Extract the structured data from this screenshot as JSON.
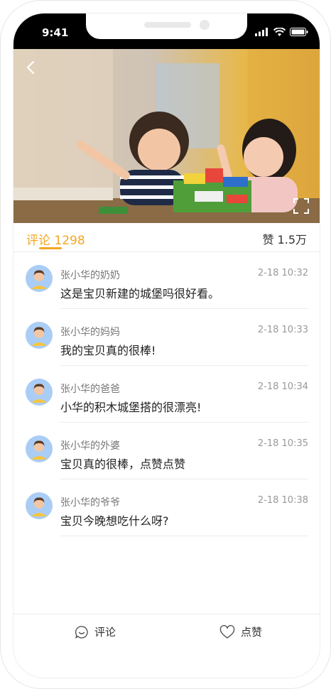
{
  "status_bar": {
    "time": "9:41"
  },
  "tabs": {
    "comments_label": "评论",
    "comments_count": "1298",
    "likes_label": "赞",
    "likes_count": "1.5万"
  },
  "comments": [
    {
      "name": "张小华的奶奶",
      "time": "2-18 10:32",
      "text": "这是宝贝新建的城堡吗很好看。"
    },
    {
      "name": "张小华的妈妈",
      "time": "2-18 10:33",
      "text": "我的宝贝真的很棒!"
    },
    {
      "name": "张小华的爸爸",
      "time": "2-18 10:34",
      "text": "小华的积木城堡搭的很漂亮!"
    },
    {
      "name": "张小华的外婆",
      "time": "2-18 10:35",
      "text": "宝贝真的很棒，点赞点赞"
    },
    {
      "name": "张小华的爷爷",
      "time": "2-18 10:38",
      "text": "宝贝今晚想吃什么呀?"
    }
  ],
  "bottom_bar": {
    "comment_label": "评论",
    "like_label": "点赞"
  },
  "colors": {
    "accent": "#f5a623",
    "avatar_bg": "#aacdf5"
  },
  "icons": {
    "back": "chevron-left-icon",
    "fullscreen": "fullscreen-icon",
    "comment": "chat-bubble-icon",
    "like": "heart-icon",
    "avatar": "person-avatar-icon"
  }
}
